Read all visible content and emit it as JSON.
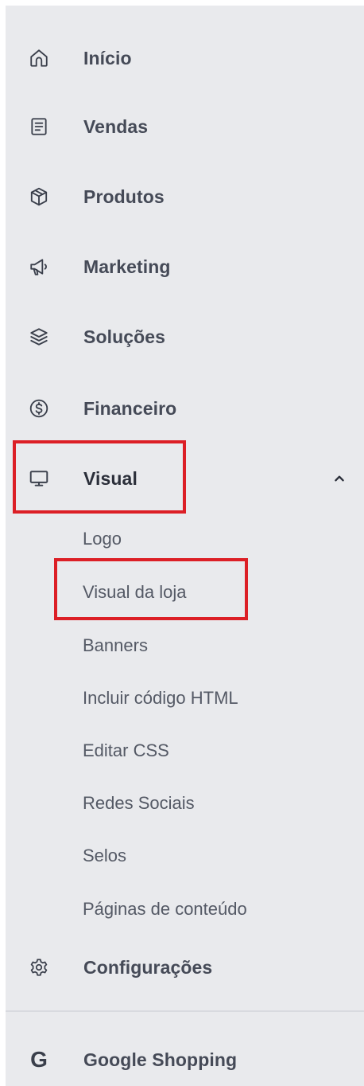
{
  "menu": {
    "items": [
      {
        "label": "Início",
        "icon": "home-icon"
      },
      {
        "label": "Vendas",
        "icon": "receipt-icon"
      },
      {
        "label": "Produtos",
        "icon": "box-icon"
      },
      {
        "label": "Marketing",
        "icon": "megaphone-icon"
      },
      {
        "label": "Soluções",
        "icon": "layers-icon"
      },
      {
        "label": "Financeiro",
        "icon": "dollar-circle-icon"
      },
      {
        "label": "Visual",
        "icon": "monitor-icon",
        "expanded": true
      }
    ],
    "visual_submenu": [
      {
        "label": "Logo"
      },
      {
        "label": "Visual da loja"
      },
      {
        "label": "Banners"
      },
      {
        "label": "Incluir código HTML"
      },
      {
        "label": "Editar CSS"
      },
      {
        "label": "Redes Sociais"
      },
      {
        "label": "Selos"
      },
      {
        "label": "Páginas de conteúdo"
      }
    ],
    "settings": {
      "label": "Configurações",
      "icon": "gear-icon"
    },
    "google": {
      "label": "Google Shopping",
      "icon": "google-icon",
      "glyph": "G"
    }
  },
  "highlight_color": "#dc1f26",
  "background_color": "#e9eaed"
}
